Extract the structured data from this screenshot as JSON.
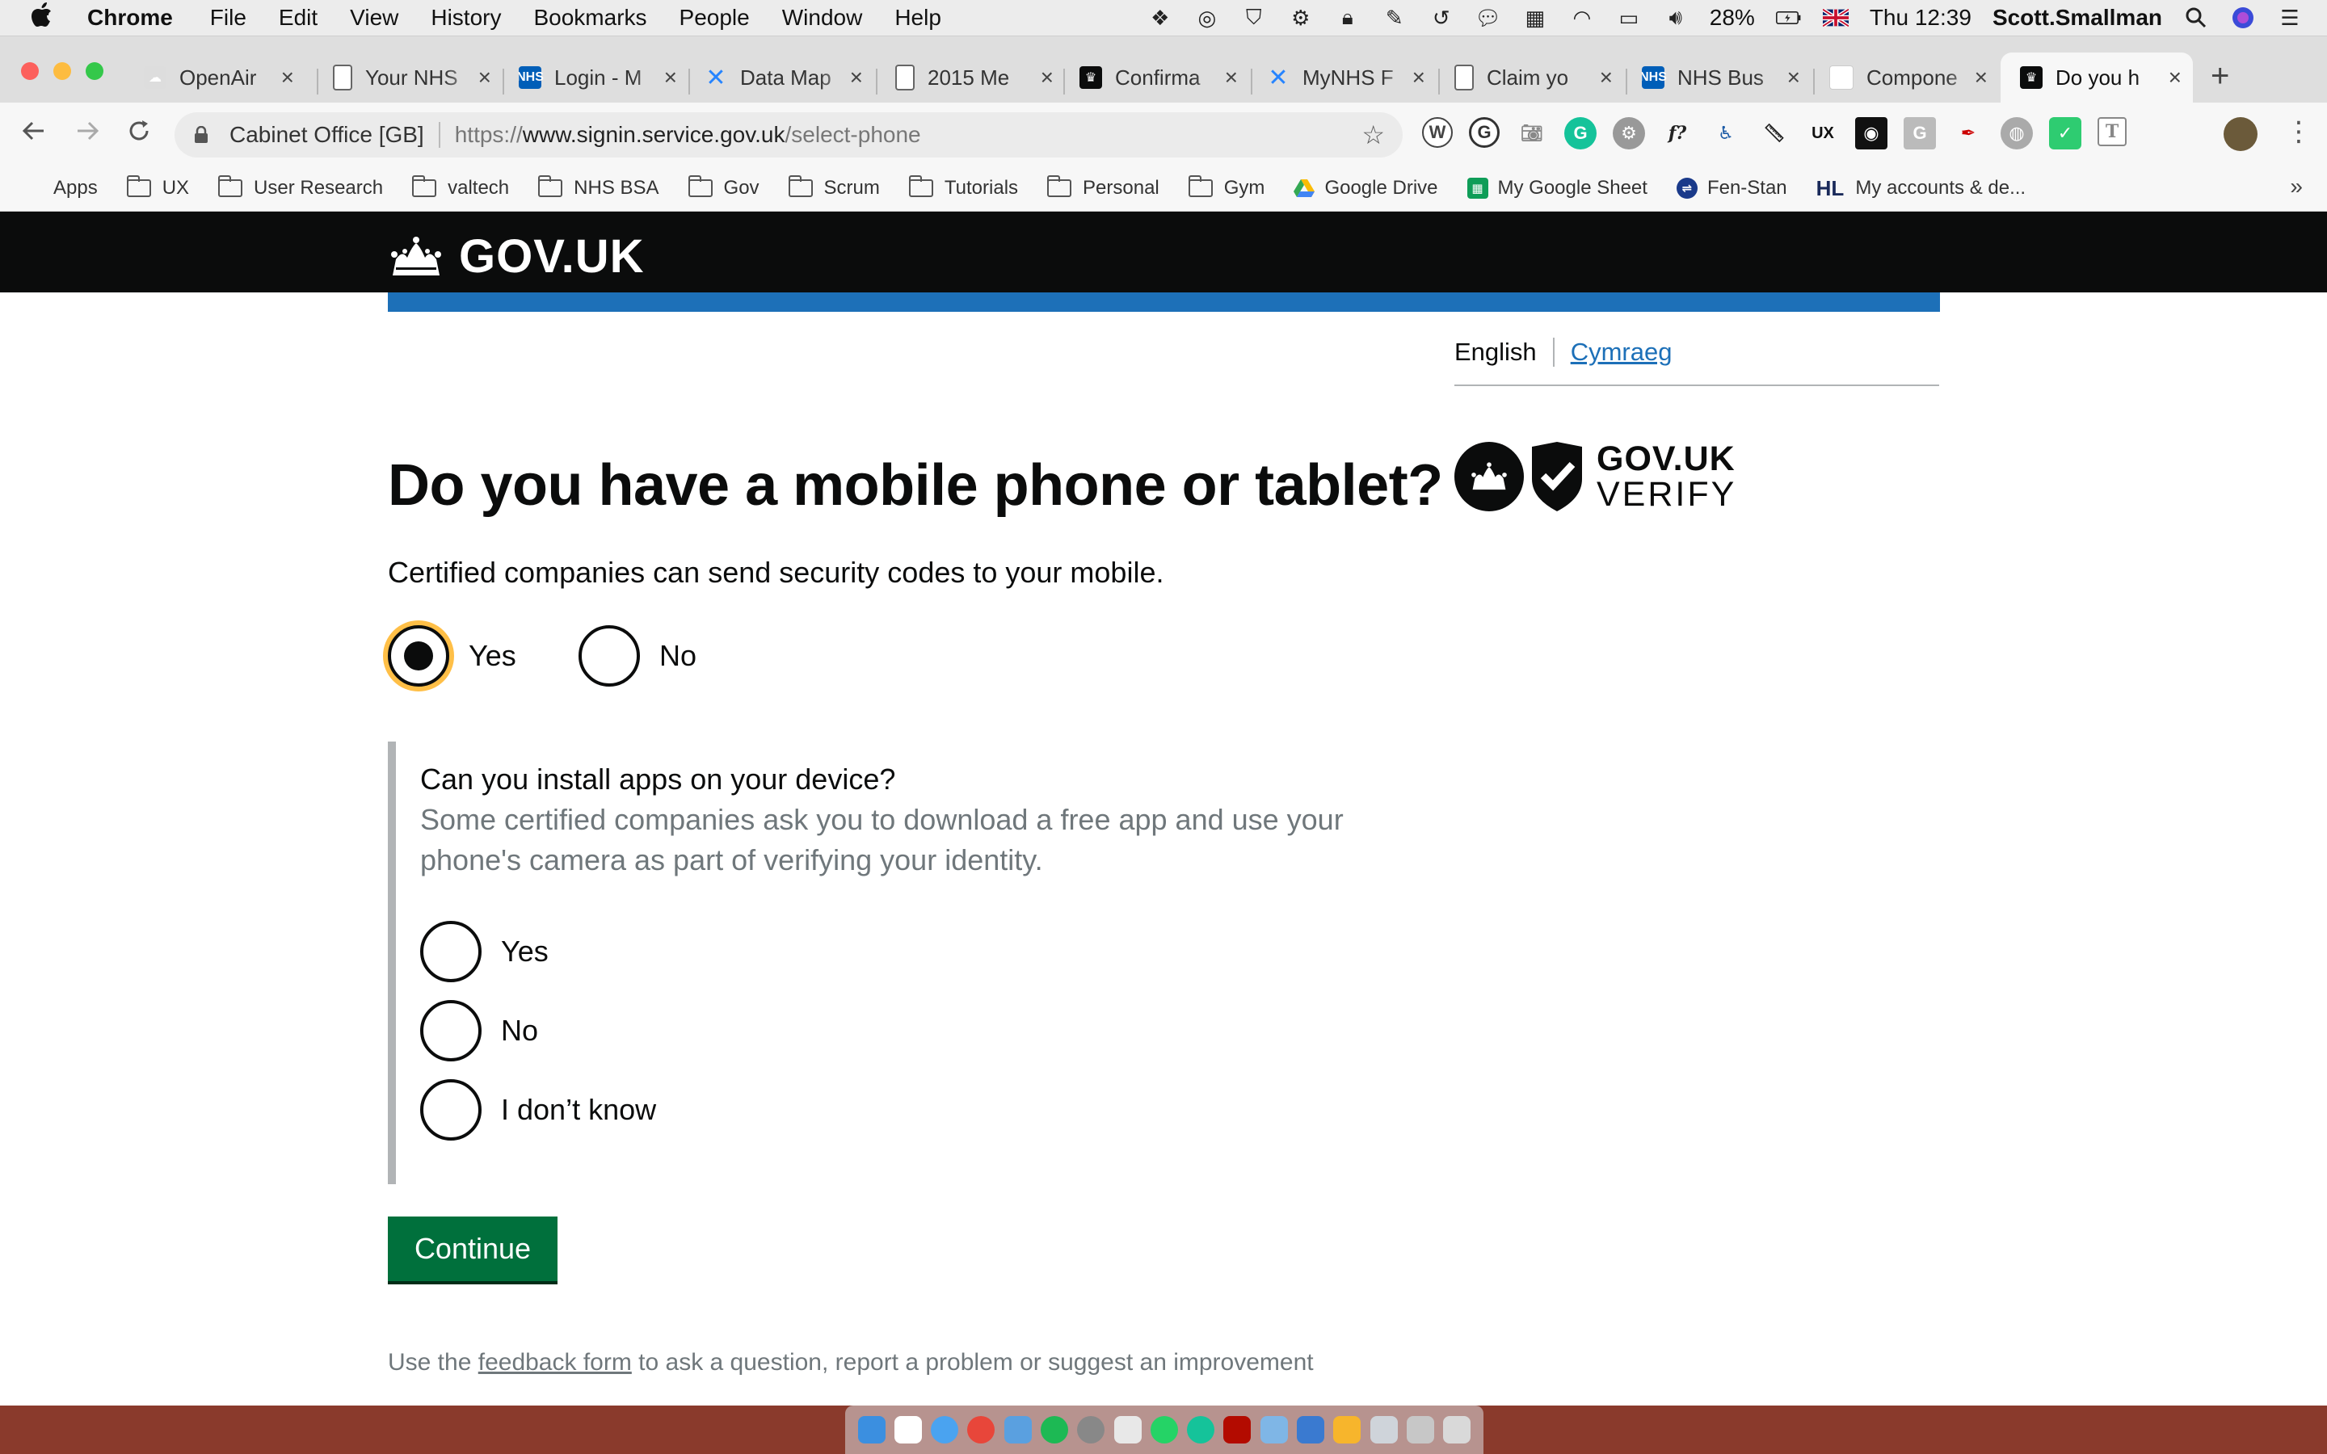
{
  "menubar": {
    "app_name": "Chrome",
    "items": [
      "File",
      "Edit",
      "View",
      "History",
      "Bookmarks",
      "People",
      "Window",
      "Help"
    ],
    "battery": "28%",
    "clock": "Thu 12:39",
    "user": "Scott.Smallman"
  },
  "tabs": [
    {
      "label": "OpenAir",
      "color": "#ffffff"
    },
    {
      "label": "Your NHS",
      "color": "#ffffff"
    },
    {
      "label": "Login - M",
      "color": "#005eb8",
      "fav_text": "NHS"
    },
    {
      "label": "Data Map",
      "color": "#2684ff"
    },
    {
      "label": "2015 Me",
      "color": "#ffffff"
    },
    {
      "label": "Confirma",
      "color": "#0b0c0c"
    },
    {
      "label": "MyNHS F",
      "color": "#2684ff"
    },
    {
      "label": "Claim yo",
      "color": "#ffffff"
    },
    {
      "label": "NHS Bus",
      "color": "#005eb8",
      "fav_text": "NHS"
    },
    {
      "label": "Compone",
      "color": "#ffffff"
    },
    {
      "label": "Do you h",
      "color": "#0b0c0c",
      "active": true
    }
  ],
  "omnibox": {
    "site_identity": "Cabinet Office [GB]",
    "url_scheme": "https://",
    "url_host": "www.signin.service.gov.uk",
    "url_path": "/select-phone"
  },
  "bookmarks": [
    {
      "label": "Apps",
      "type": "apps"
    },
    {
      "label": "UX",
      "type": "folder"
    },
    {
      "label": "User Research",
      "type": "folder"
    },
    {
      "label": "valtech",
      "type": "folder"
    },
    {
      "label": "NHS BSA",
      "type": "folder"
    },
    {
      "label": "Gov",
      "type": "folder"
    },
    {
      "label": "Scrum",
      "type": "folder"
    },
    {
      "label": "Tutorials",
      "type": "folder"
    },
    {
      "label": "Personal",
      "type": "folder"
    },
    {
      "label": "Gym",
      "type": "folder"
    },
    {
      "label": "Google Drive",
      "type": "drive"
    },
    {
      "label": "My Google Sheet",
      "type": "sheet"
    },
    {
      "label": "Fen-Stan",
      "type": "rail"
    },
    {
      "label": "My accounts & de...",
      "type": "hl",
      "prefix": "HL"
    }
  ],
  "page": {
    "logotype": "GOV.UK",
    "lang_current": "English",
    "lang_other": "Cymraeg",
    "verify_line1": "GOV.UK",
    "verify_line2": "VERIFY",
    "heading": "Do you have a mobile phone or tablet?",
    "hint": "Certified companies can send security codes to your mobile.",
    "q1_options": [
      {
        "label": "Yes",
        "checked": true
      },
      {
        "label": "No",
        "checked": false
      }
    ],
    "q2_label": "Can you install apps on your device?",
    "q2_hint_line1": "Some certified companies ask you to download a free app and use your",
    "q2_hint_line2": "phone's camera as part of verifying your identity.",
    "q2_options": [
      {
        "label": "Yes",
        "checked": false
      },
      {
        "label": "No",
        "checked": false
      },
      {
        "label": "I don’t know",
        "checked": false
      }
    ],
    "continue": "Continue",
    "footer_prefix": "Use the ",
    "footer_link": "feedback form",
    "footer_suffix": " to ask a question, report a problem or suggest an improvement"
  },
  "colors": {
    "header_black": "#0b0c0c",
    "brand_blue": "#1d70b8",
    "button_green": "#00703c",
    "focus_yellow": "#ffbf47",
    "hint_grey": "#6f777b"
  }
}
